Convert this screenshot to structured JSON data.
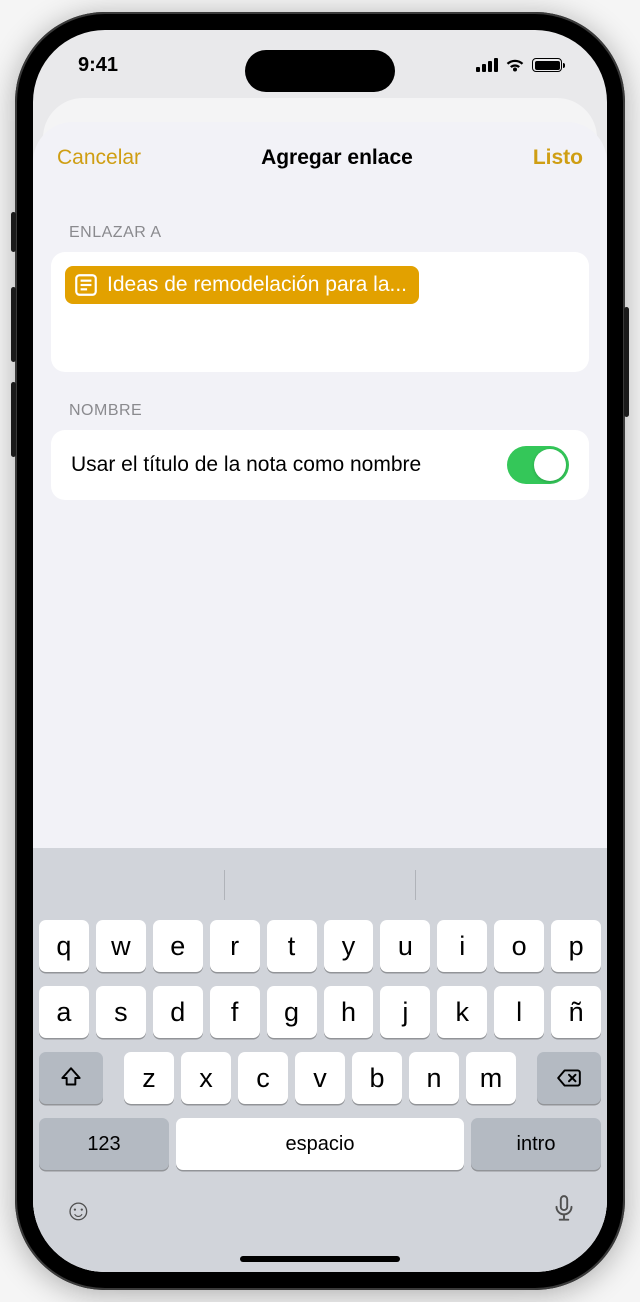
{
  "status": {
    "time": "9:41"
  },
  "colors": {
    "accent": "#cf9e13",
    "switch_on": "#34c759"
  },
  "sheet": {
    "cancel": "Cancelar",
    "title": "Agregar enlace",
    "done": "Listo"
  },
  "link_section": {
    "label": "ENLAZAR A",
    "chip_icon": "note-icon",
    "chip_text": "Ideas de remodelación para la..."
  },
  "name_section": {
    "label": "NOMBRE",
    "toggle_label": "Usar el título de la nota como nombre",
    "toggle_on": true
  },
  "keyboard": {
    "row1": [
      "q",
      "w",
      "e",
      "r",
      "t",
      "y",
      "u",
      "i",
      "o",
      "p"
    ],
    "row2": [
      "a",
      "s",
      "d",
      "f",
      "g",
      "h",
      "j",
      "k",
      "l",
      "ñ"
    ],
    "row3": [
      "z",
      "x",
      "c",
      "v",
      "b",
      "n",
      "m"
    ],
    "mode": "123",
    "space": "espacio",
    "enter": "intro"
  }
}
